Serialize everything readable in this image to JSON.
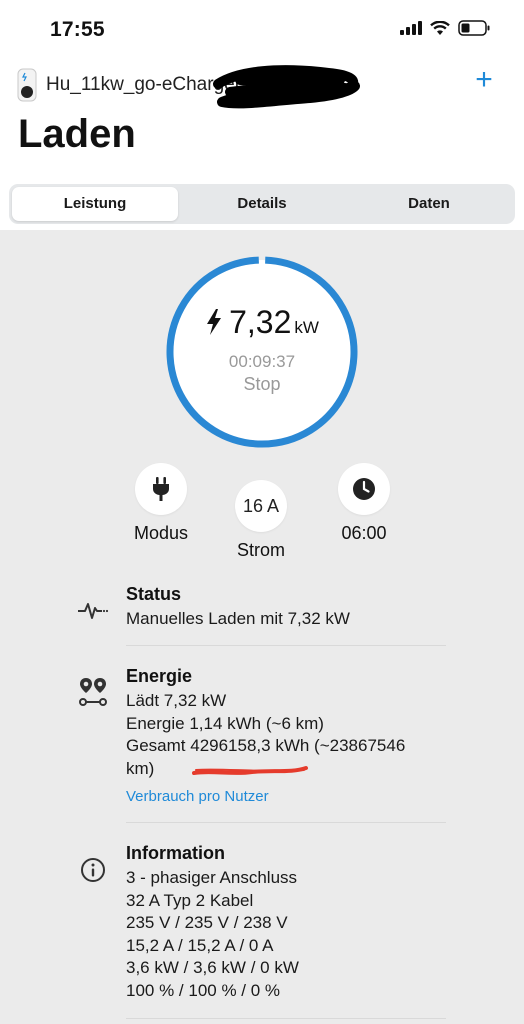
{
  "statusbar": {
    "time": "17:55"
  },
  "header": {
    "device_name": "Hu_11kw_go-eCharger",
    "title": "Laden"
  },
  "tabs": [
    {
      "label": "Leistung"
    },
    {
      "label": "Details"
    },
    {
      "label": "Daten"
    }
  ],
  "gauge": {
    "power_value": "7,32",
    "power_unit": "kW",
    "elapsed": "00:09:37",
    "stop_label": "Stop"
  },
  "controls": {
    "mode_label": "Modus",
    "current_value": "16 A",
    "current_label": "Strom",
    "timer_label": "06:00"
  },
  "status": {
    "heading": "Status",
    "text": "Manuelles Laden mit 7,32 kW"
  },
  "energy": {
    "heading": "Energie",
    "lines": [
      "Lädt 7,32 kW",
      "Energie 1,14 kWh (~6 km)",
      "Gesamt 4296158,3 kWh (~23867546",
      "km)"
    ],
    "link": "Verbrauch pro Nutzer"
  },
  "information": {
    "heading": "Information",
    "lines": [
      "3 - phasiger Anschluss",
      "32 A Typ 2 Kabel",
      "235 V / 235 V / 238 V",
      "15,2 A / 15,2 A / 0 A",
      "3,6 kW / 3,6 kW / 0 kW",
      "100 % / 100 % / 0 %"
    ]
  },
  "colors": {
    "accent": "#1f8ad8",
    "ring": "#2a88d4",
    "background": "#ebebeb"
  }
}
